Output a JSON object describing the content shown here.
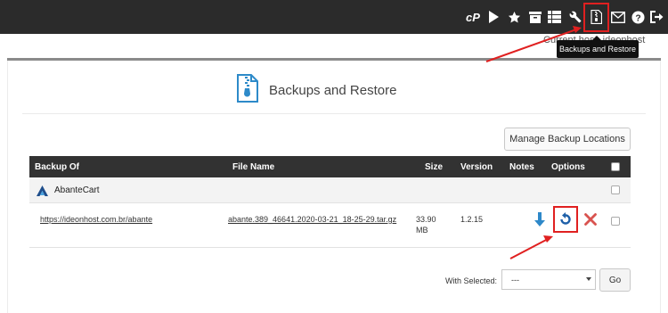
{
  "topbar": {
    "icons": [
      "cpanel-logo-icon",
      "play-icon",
      "star-icon",
      "archive-icon",
      "list-icon",
      "wrench-icon",
      "zip-file-icon",
      "mail-icon",
      "help-icon",
      "logout-icon"
    ],
    "cp_text": "cP",
    "host_text": "Current host: ideonhost",
    "tooltip": "Backups and Restore"
  },
  "page": {
    "title": "Backups and Restore",
    "icon": "zip-file-icon"
  },
  "manage_button": "Manage Backup Locations",
  "table": {
    "headers": [
      "Backup Of",
      "File Name",
      "Size",
      "Version",
      "Notes",
      "Options"
    ],
    "group": {
      "name": "AbanteCart",
      "icon": "abantecart-logo-icon"
    },
    "rows": [
      {
        "backup_of": "https://ideonhost.com.br/abante",
        "file_name": "abante.389_46641.2020-03-21_18-25-29.tar.gz",
        "size": "33.90 MB",
        "version": "1.2.15",
        "notes": "",
        "options": [
          "download-icon",
          "restore-icon",
          "delete-icon"
        ]
      }
    ]
  },
  "bulk": {
    "label": "With Selected:",
    "selected": "---",
    "go": "Go"
  },
  "colors": {
    "topbar": "#2b2b2b",
    "table_header": "#323232",
    "highlight": "#e02020",
    "download": "#2e88c9",
    "restore": "#1e5fa8",
    "delete": "#d9534f"
  }
}
